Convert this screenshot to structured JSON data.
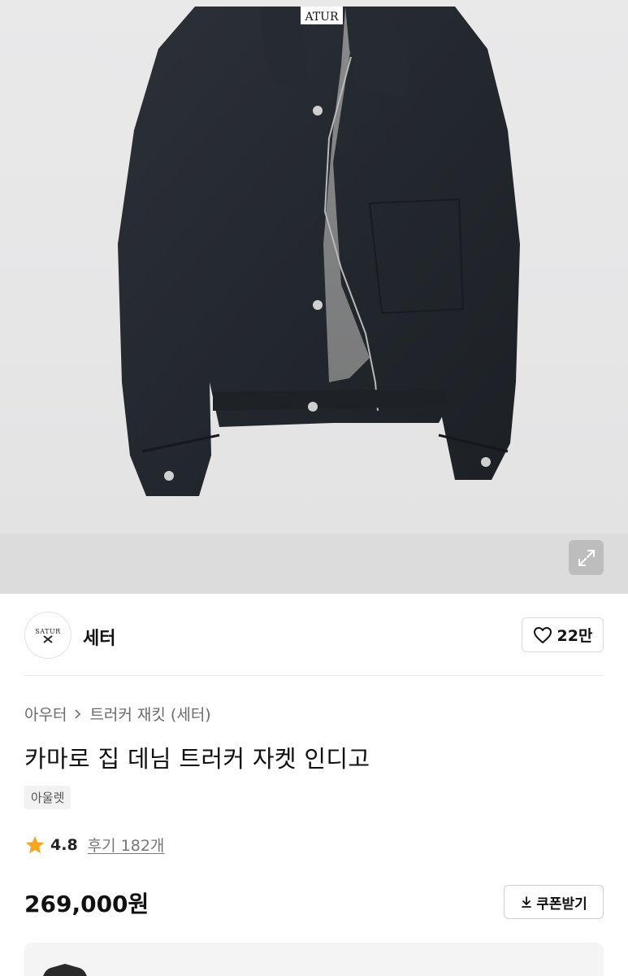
{
  "hero": {
    "image_label": "ATUR",
    "expand_icon": "expand-icon"
  },
  "brand": {
    "logo_text_top": "SATUR",
    "name": "세터",
    "like_icon": "heart-icon",
    "like_count": "22만"
  },
  "breadcrumb": {
    "items": [
      "아우터",
      "트러커 재킷 (세터)"
    ],
    "separator_icon": "chevron-right-icon"
  },
  "product": {
    "title": "카마로 집 데님 트러커 자켓 인디고",
    "tag": "아울렛",
    "rating": "4.8",
    "review_label": "후기 182개",
    "star_color": "#f5a623",
    "price": "269,000원",
    "coupon_icon": "download-icon",
    "coupon_label": "쿠폰받기"
  }
}
